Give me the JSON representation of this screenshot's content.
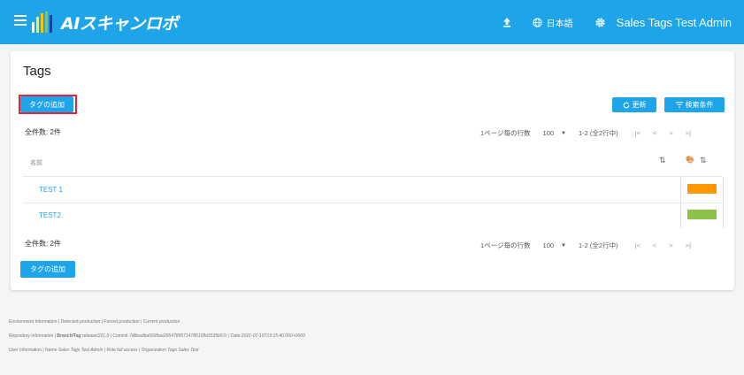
{
  "header": {
    "logo_text": "AIスキャンロボ",
    "language": "日本語",
    "user": "Sales Tags Test Admin",
    "bg_color": "#1ea4e8"
  },
  "card": {
    "title": "Tags",
    "add_label": "タグの追加",
    "refresh_label": "更新",
    "filter_label": "検索条件",
    "total": "全件数: 2件",
    "pager": {
      "rows_per_page_label": "1ページ毎の行数",
      "rows_per_page": "100",
      "range": "1-2 (全2行中)"
    },
    "column_name": "名前",
    "rows": [
      {
        "name": "TEST 1",
        "color": "#ff9800"
      },
      {
        "name": "TEST2",
        "color": "#8bc34a"
      }
    ]
  },
  "footer": {
    "env_label": "Environment Information",
    "detected_label": "Detected",
    "detected": "production",
    "forced_label": "Forced",
    "forced": "production",
    "current_label": "Current",
    "current": "production",
    "repo_label": "Repository Information",
    "branch_label": "Branch/Tag",
    "branch": "release/221.0",
    "commit_label": "Commit",
    "commit": "7d8eadba5695ee29547895714780168d3535b57c",
    "date_label": "Date",
    "date": "2021-07-10T19:15:40.000+0000",
    "user_label": "User Information",
    "name_label": "Name",
    "name": "Sales Tags Test Admin",
    "role_label": "Role",
    "role": "full access",
    "org_label": "Organization",
    "org": "Tags Sales Test"
  }
}
